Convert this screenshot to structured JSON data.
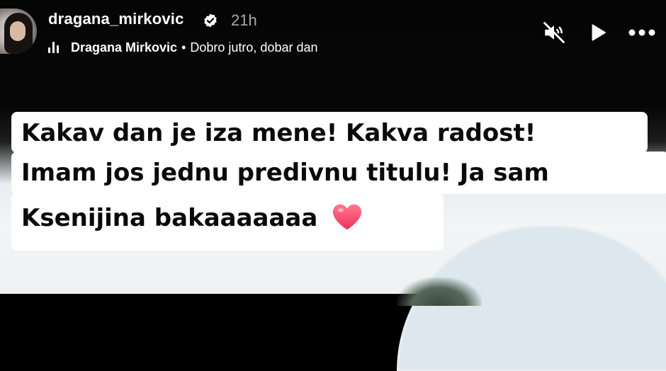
{
  "header": {
    "username": "dragana_mirkovic",
    "time": "21h",
    "music": {
      "artist": "Dragana Mirkovic",
      "separator": "•",
      "song": "Dobro jutro, dobar dan"
    },
    "icons": {
      "verified": "verified-badge-icon",
      "mute": "muted-speaker-icon",
      "play": "play-icon",
      "more": "more-options-icon",
      "music": "music-bars-icon"
    }
  },
  "caption": {
    "lines": [
      "Kakav dan je iza mene! Kakva radost!",
      "Imam jos jednu predivnu titulu! Ja sam",
      "Ksenijina bakaaaaaaa"
    ],
    "emoji": "heart-emoji"
  },
  "colors": {
    "background": "#000000",
    "caption_bg": "#ffffff",
    "caption_text": "#0a0a0a",
    "heart": "#ff5a78"
  }
}
